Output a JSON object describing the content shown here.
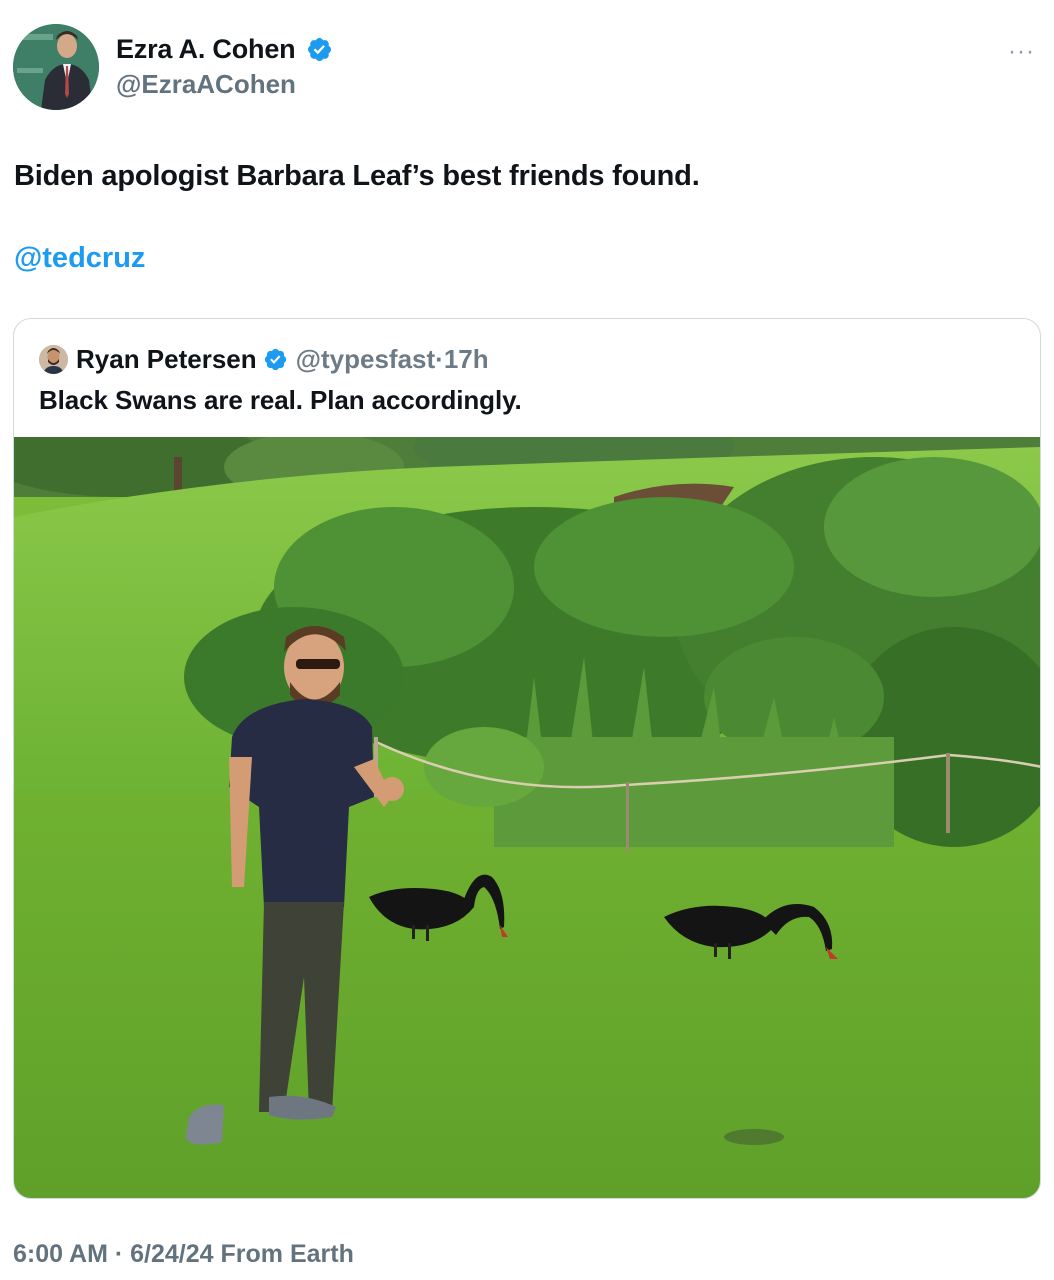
{
  "author": {
    "display_name": "Ezra A. Cohen",
    "handle": "@EzraACohen",
    "avatar_icon": "profile-photo",
    "verified_icon": "verified-badge-icon"
  },
  "tweet": {
    "text": "Biden apologist Barbara Leaf’s best friends found.",
    "mention": "@tedcruz",
    "more_icon": "more-options-icon",
    "more_label": "···"
  },
  "quoted": {
    "display_name": "Ryan Petersen",
    "handle_time": "@typesfast·17h",
    "text": "Black Swans are real. Plan accordingly.",
    "photo_icon": "photo-of-man-with-black-swans"
  },
  "footer": {
    "meta": "6:00 AM · 6/24/24 From Earth"
  },
  "colors": {
    "accent": "#1d9bf0",
    "muted": "#536471",
    "border": "#cfd9de"
  }
}
